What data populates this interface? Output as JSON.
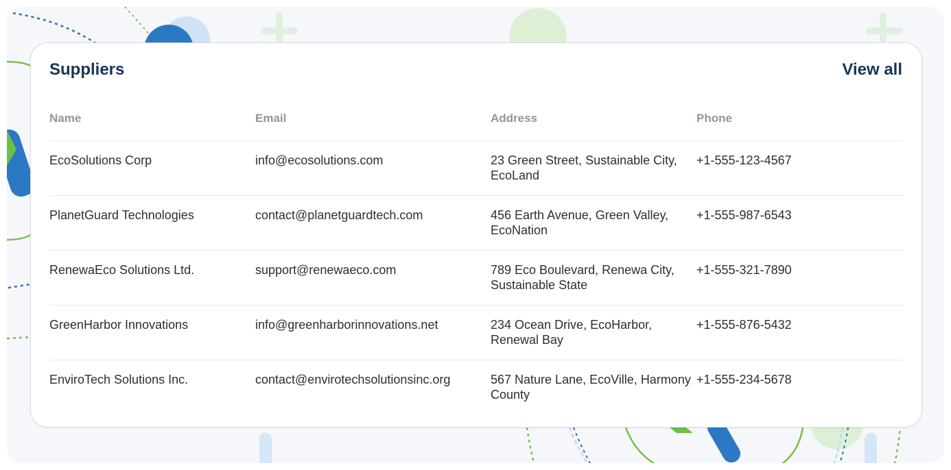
{
  "card": {
    "title": "Suppliers",
    "view_all_label": "View all"
  },
  "table": {
    "headers": {
      "name": "Name",
      "email": "Email",
      "address": "Address",
      "phone": "Phone"
    },
    "rows": [
      {
        "name": "EcoSolutions Corp",
        "email": "info@ecosolutions.com",
        "address": "23 Green Street, Sustainable City, EcoLand",
        "phone": "+1-555-123-4567"
      },
      {
        "name": "PlanetGuard Technologies",
        "email": "contact@planetguardtech.com",
        "address": "456 Earth Avenue, Green Valley, EcoNation",
        "phone": "+1-555-987-6543"
      },
      {
        "name": "RenewaEco Solutions Ltd.",
        "email": "support@renewaeco.com",
        "address": "789 Eco Boulevard, Renewa City, Sustainable State",
        "phone": "+1-555-321-7890"
      },
      {
        "name": "GreenHarbor Innovations",
        "email": "info@greenharborinnovations.net",
        "address": "234 Ocean Drive, EcoHarbor, Renewal Bay",
        "phone": "+1-555-876-5432"
      },
      {
        "name": "EnviroTech Solutions Inc.",
        "email": "contact@envirotechsolutionsinc.org",
        "address": "567 Nature Lane, EcoVille, Harmony County",
        "phone": "+1-555-234-5678"
      }
    ]
  },
  "colors": {
    "title": "#163558",
    "header_text": "#8f969e",
    "body_text": "#2b2f33",
    "accent_blue": "#1f6fbf",
    "accent_green": "#74c043",
    "background": "#f5f7fa"
  }
}
